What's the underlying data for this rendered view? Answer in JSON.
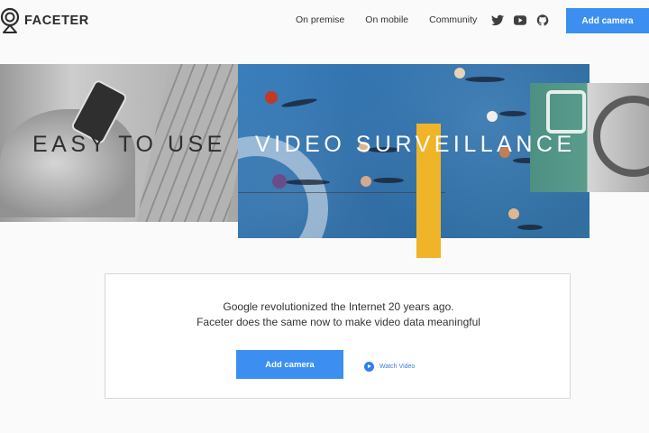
{
  "brand": {
    "name": "FACETER",
    "logo_icon": "webcam-logo-icon"
  },
  "nav": {
    "items": [
      "On premise",
      "On mobile",
      "Community"
    ]
  },
  "social": {
    "icons": [
      "twitter-icon",
      "youtube-icon",
      "github-icon"
    ]
  },
  "header": {
    "cta_label": "Add camera"
  },
  "hero": {
    "left_text": "EASY TO USE",
    "right_text": "VIDEO SURVEILLANCE"
  },
  "card": {
    "tagline_line1": "Google revolutionized the Internet 20 years ago.",
    "tagline_line2": "Faceter does the same now to make video data meaningful",
    "cta_label": "Add camera",
    "watch_label": "Watch Video"
  },
  "colors": {
    "accent": "#3c8ff0",
    "court_blue": "#2f6fa8",
    "highlight_yellow": "#f0b429",
    "background": "#fafafa"
  }
}
